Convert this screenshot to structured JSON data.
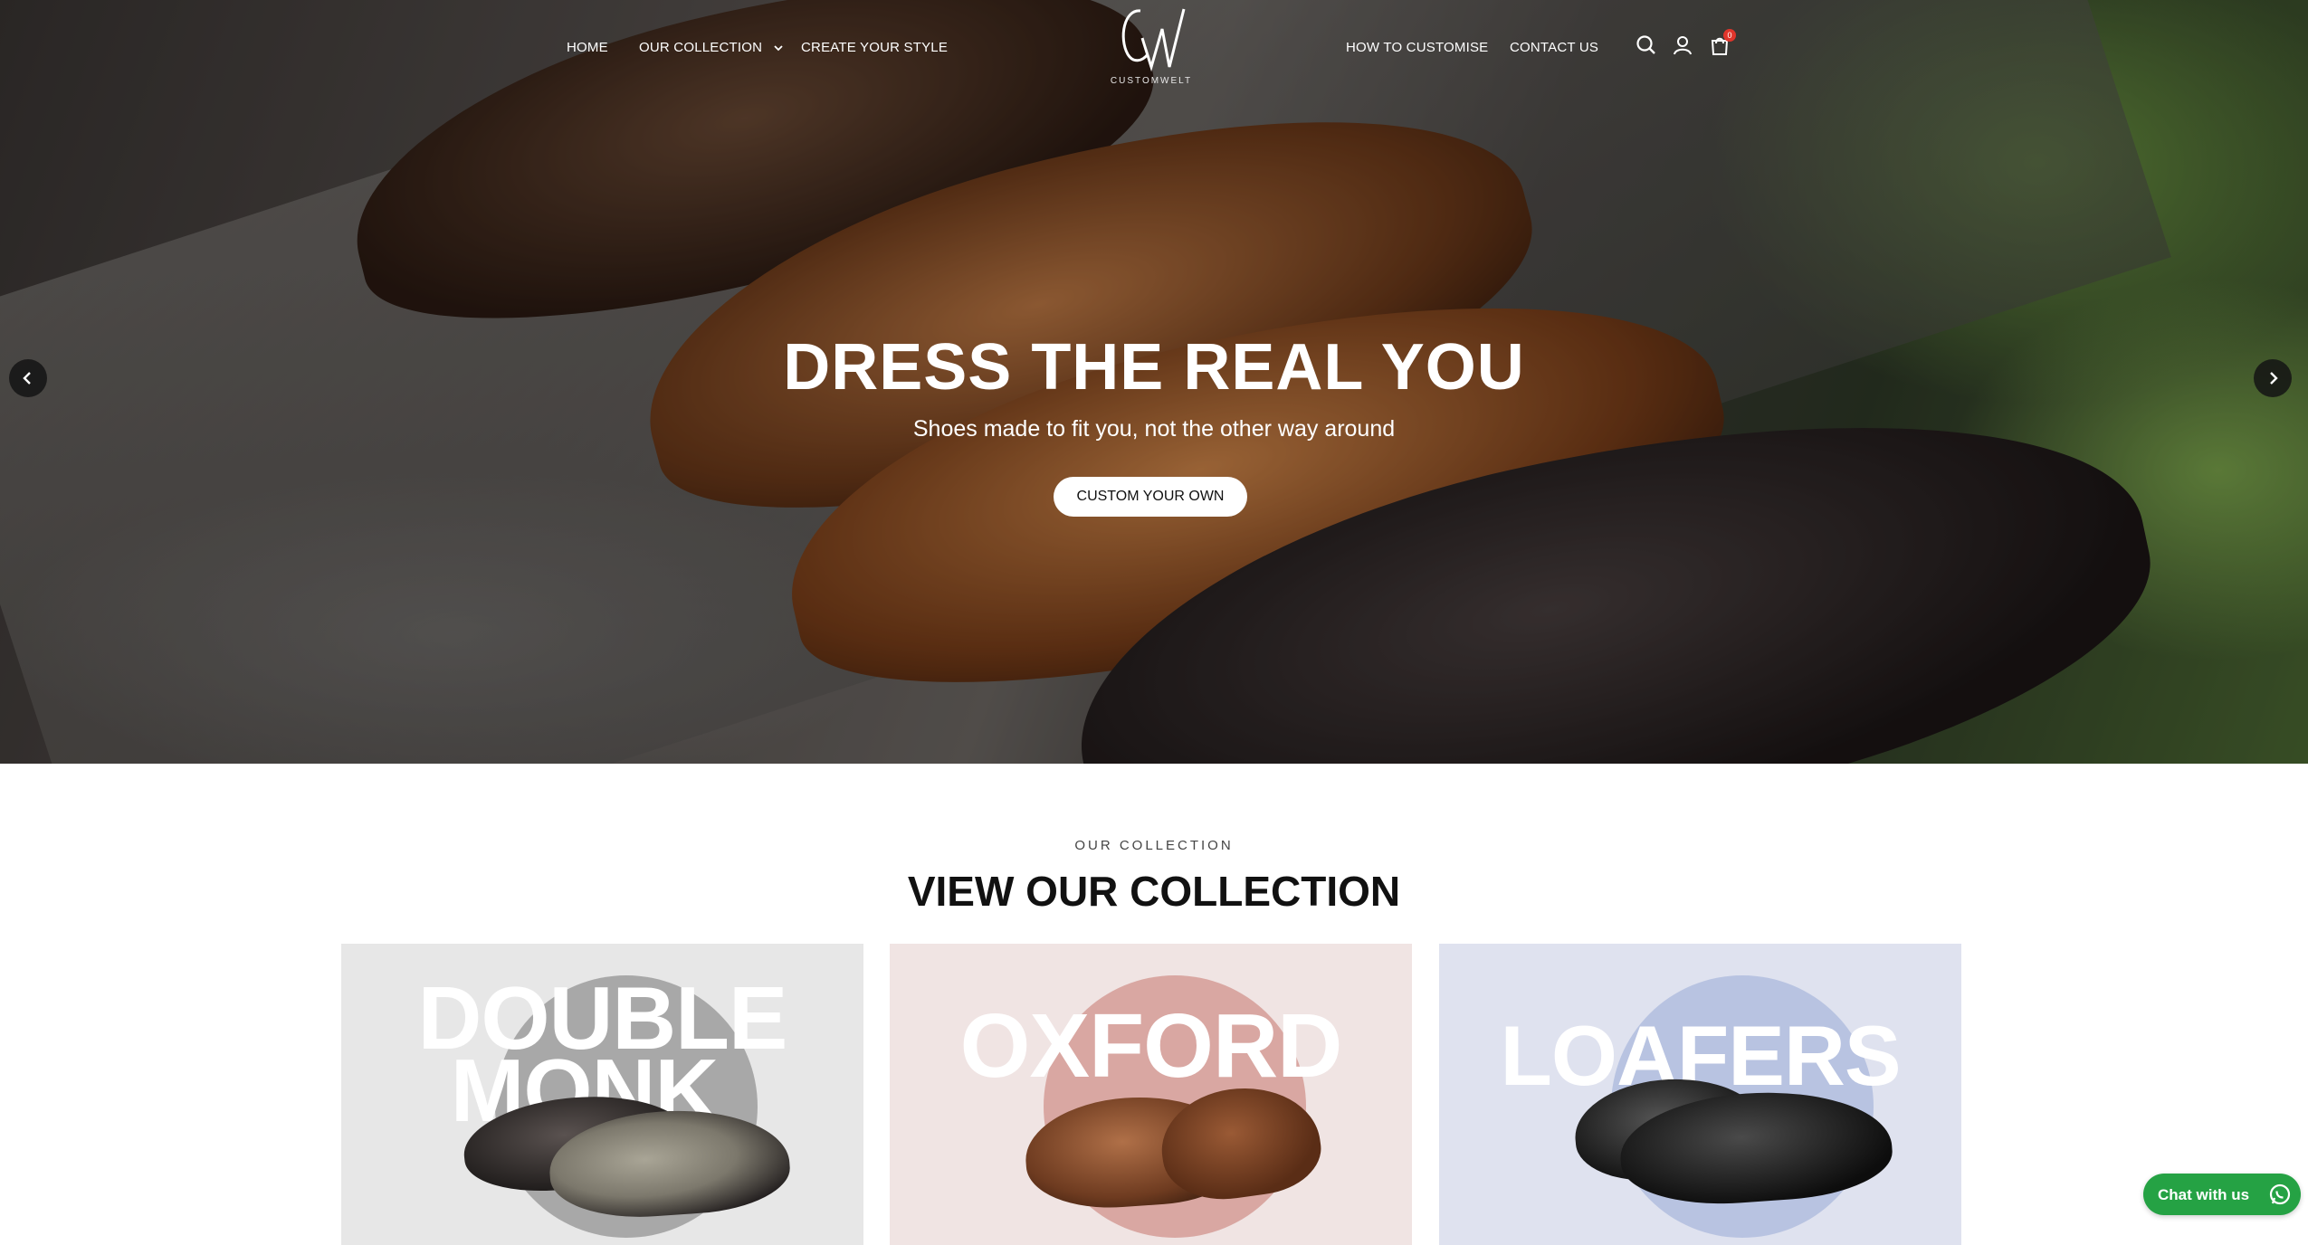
{
  "header": {
    "nav_left": [
      "HOME",
      "OUR COLLECTION",
      "CREATE YOUR STYLE"
    ],
    "nav_right": [
      "HOW TO CUSTOMISE",
      "CONTACT US"
    ],
    "logo_text": "CUSTOMWELT",
    "cart_count": "0",
    "icons": [
      "search-icon",
      "account-icon",
      "cart-icon"
    ]
  },
  "hero": {
    "title": "DRESS THE REAL YOU",
    "subtitle": "Shoes made to fit you, not the other way around",
    "cta_label": "CUSTOM YOUR OWN"
  },
  "collection": {
    "eyebrow": "OUR COLLECTION",
    "title": "VIEW OUR COLLECTION",
    "cards": [
      {
        "label": "DOUBLE MONK",
        "line1": "DOUBLE",
        "line2": "MONK",
        "bg": "#e7e7e7",
        "circle": "#a8a8a8"
      },
      {
        "label": "OXFORD",
        "bg": "#f0e4e3",
        "circle": "#d9a7a2"
      },
      {
        "label": "LOAFERS",
        "bg": "#dfe2ef",
        "circle": "#b8c3e1"
      }
    ]
  },
  "chat": {
    "label": "Chat with us",
    "color": "#25a244"
  }
}
